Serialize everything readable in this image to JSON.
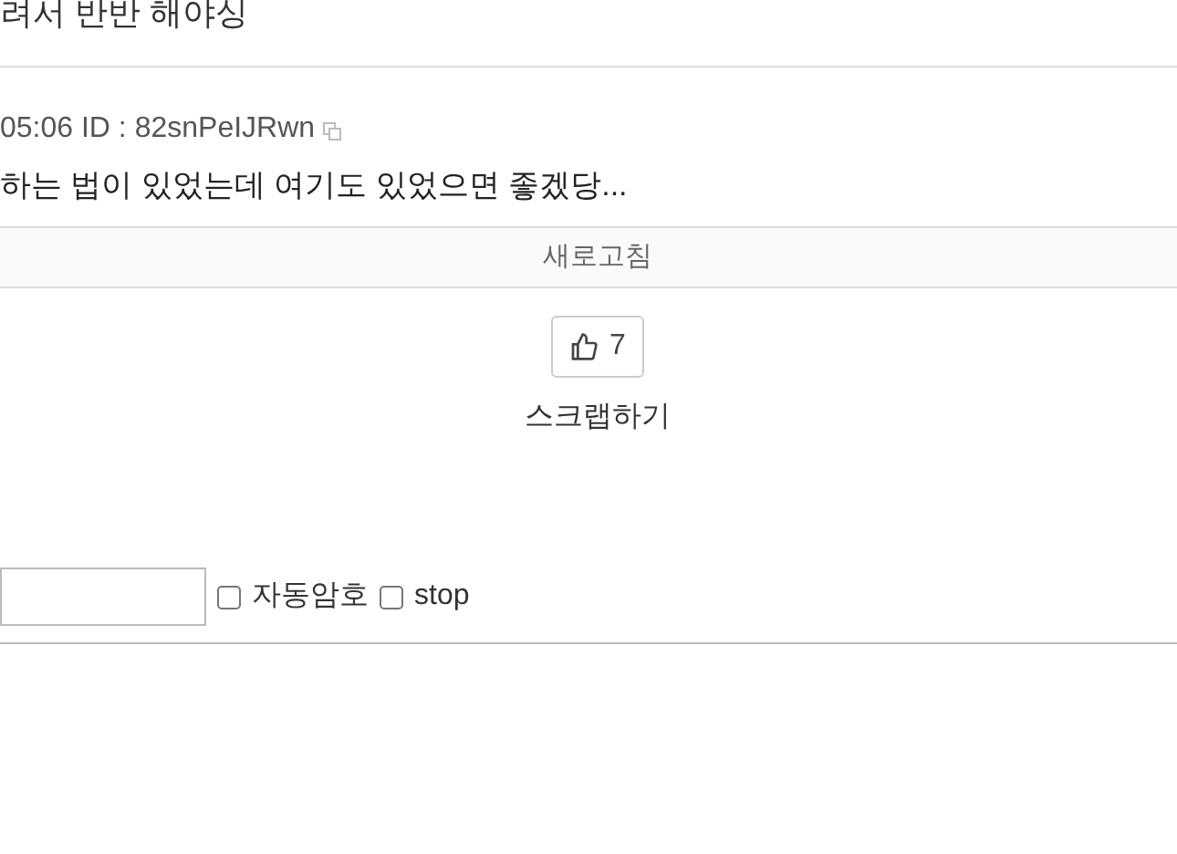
{
  "title": "려서 반반 해야싱",
  "comment": {
    "meta": "05:06 ID : 82snPeIJRwn",
    "body": "하는 법이 있었는데 여기도 있었으면 좋겠당..."
  },
  "refresh": "새로고침",
  "like": {
    "count": "7"
  },
  "scrap": "스크랩하기",
  "form": {
    "options": [
      {
        "label": "자동암호",
        "checked": false
      },
      {
        "label": "stop",
        "checked": false
      }
    ]
  }
}
